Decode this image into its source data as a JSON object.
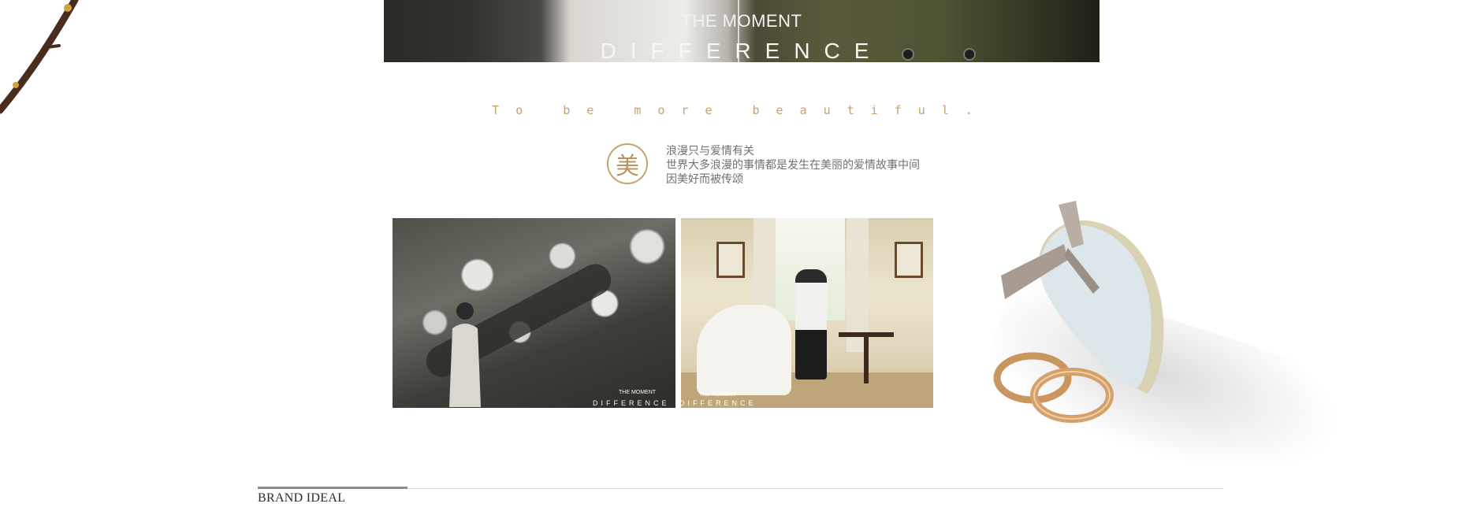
{
  "hero": {
    "line1": "THE MOMENT",
    "line2": "DIFFERENCE"
  },
  "tagline": "To be more beautiful.",
  "emblem": {
    "character": "美"
  },
  "intro": {
    "lines": [
      "浪漫只与爱情有关",
      "世界大多浪漫的事情都是发生在美丽的爱情故事中间",
      "因美好而被传颂"
    ]
  },
  "photos": [
    {
      "caption_line1": "THE MOMENT",
      "caption_line2": "DIFFERENCE"
    },
    {
      "caption_line1": "THE MOMENT",
      "caption_line2": "DIFFERENCE"
    }
  ],
  "section": {
    "title": "BRAND IDEAL"
  },
  "colors": {
    "accent_gold": "#c7a06a",
    "text_gray": "#6f6f6f",
    "heading_dark": "#2a2a2a"
  }
}
